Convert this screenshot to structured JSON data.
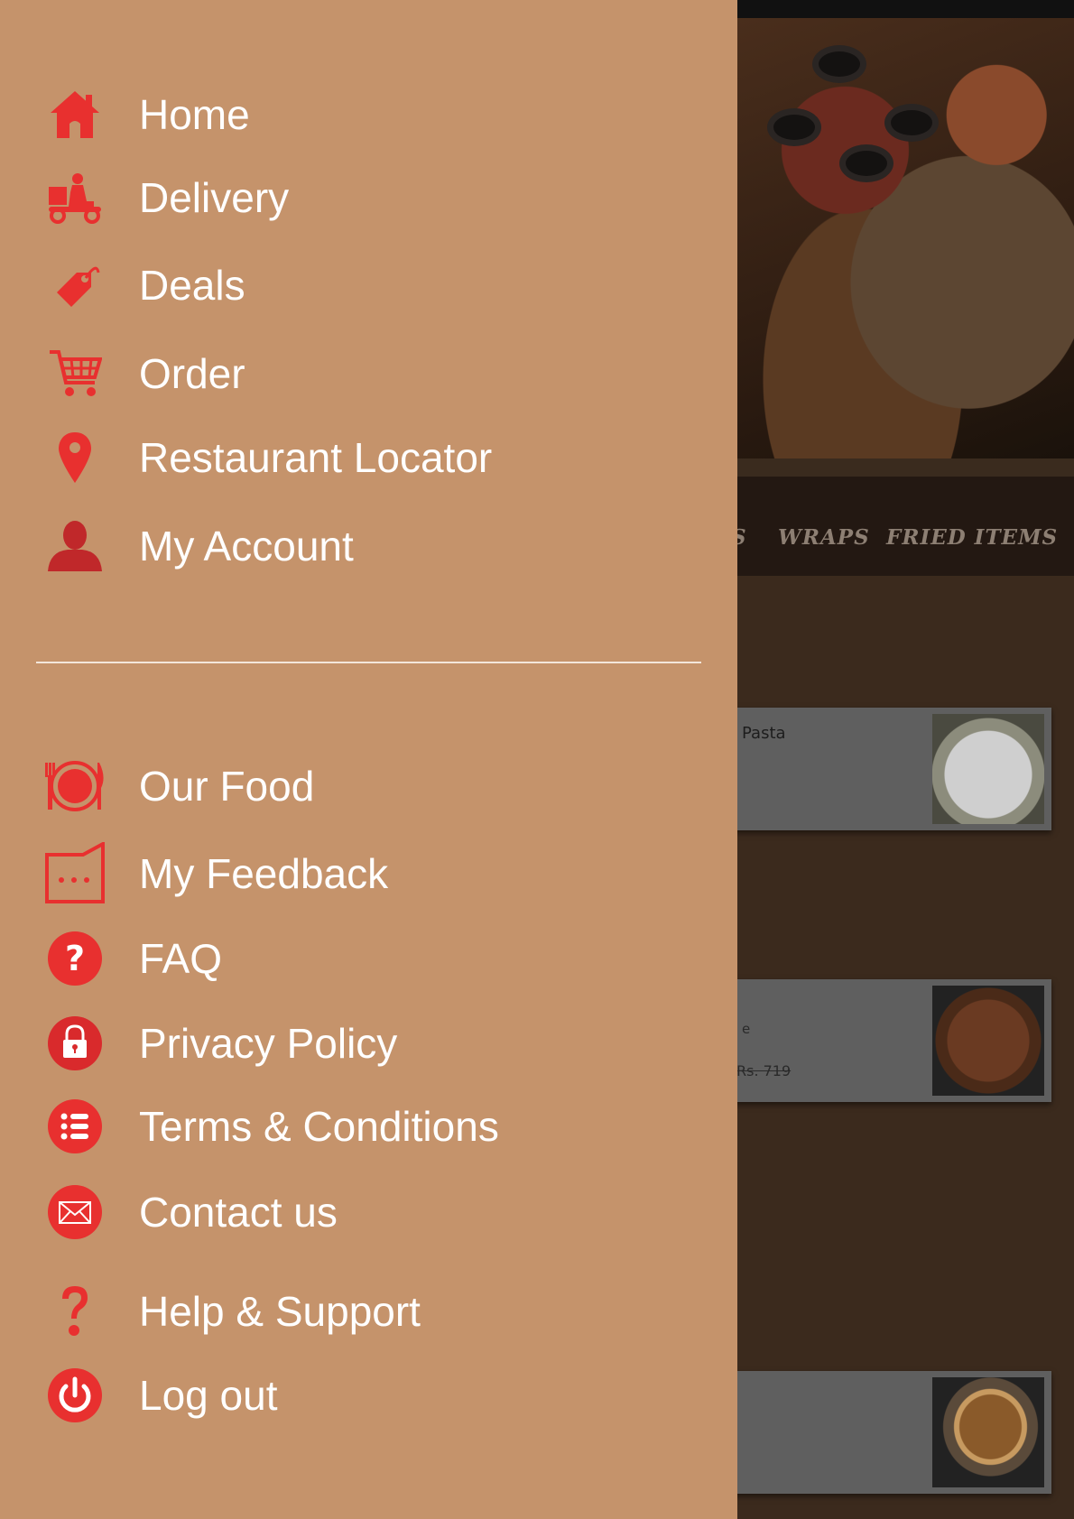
{
  "background_app": {
    "tabs": [
      "S",
      "WRAPS",
      "FRIED ITEMS"
    ],
    "cards": [
      {
        "title": "Pasta",
        "subtitle": "",
        "old_price": ""
      },
      {
        "title": "",
        "subtitle": "e",
        "old_price": "Rs. 719"
      },
      {
        "title": "",
        "subtitle": "",
        "old_price": ""
      }
    ]
  },
  "drawer": {
    "primary_items": [
      {
        "label": "Home",
        "icon": "home-icon"
      },
      {
        "label": "Delivery",
        "icon": "delivery-scooter-icon"
      },
      {
        "label": "Deals",
        "icon": "tag-icon"
      },
      {
        "label": "Order",
        "icon": "cart-icon"
      },
      {
        "label": "Restaurant Locator",
        "icon": "location-pin-icon"
      },
      {
        "label": "My Account",
        "icon": "user-icon"
      }
    ],
    "secondary_items": [
      {
        "label": "Our Food",
        "icon": "plate-cutlery-icon"
      },
      {
        "label": "My Feedback",
        "icon": "feedback-icon"
      },
      {
        "label": "FAQ",
        "icon": "question-circle-icon"
      },
      {
        "label": "Privacy Policy",
        "icon": "lock-icon"
      },
      {
        "label": "Terms & Conditions",
        "icon": "list-icon"
      },
      {
        "label": "Contact us",
        "icon": "mail-icon"
      },
      {
        "label": "Help & Support",
        "icon": "question-mark-icon"
      },
      {
        "label": "Log out",
        "icon": "power-icon"
      }
    ]
  },
  "colors": {
    "drawer_bg": "#c5936b",
    "icon_red": "#e8302f",
    "label_white": "#ffffff"
  }
}
